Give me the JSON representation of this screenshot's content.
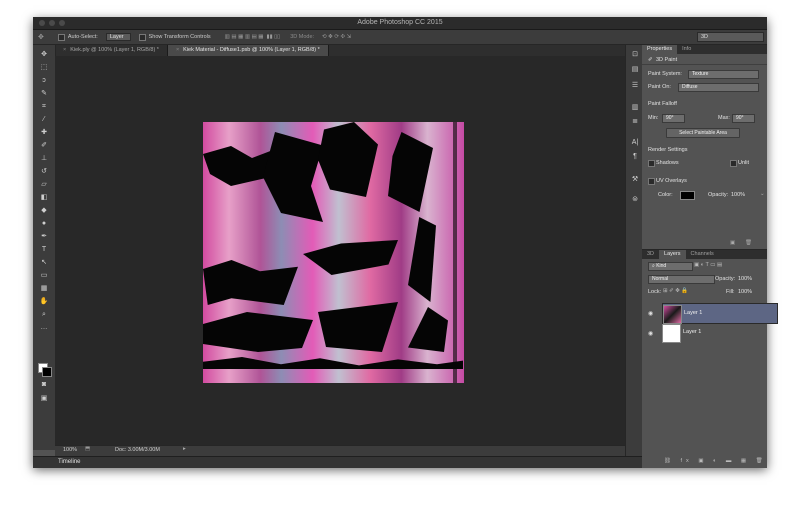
{
  "window": {
    "title": "Adobe Photoshop CC 2015"
  },
  "options_bar": {
    "auto_select_label": "Auto-Select:",
    "auto_select_value": "Layer",
    "show_transform_label": "Show Transform Controls",
    "mode_3d_label": "3D Mode:",
    "workspace_value": "3D"
  },
  "tabs": [
    {
      "label": "Kiek.ply @ 100% (Layer 1, RGB/8) *"
    },
    {
      "label": "Kiek Material - Diffuse1.psb @ 100% (Layer 1, RGB/8) *"
    }
  ],
  "status": {
    "zoom": "100%",
    "doc": "Doc: 3.00M/3.00M"
  },
  "timeline_label": "Timeline",
  "properties": {
    "tab_properties": "Properties",
    "tab_info": "Info",
    "header": "3D Paint",
    "paint_system_label": "Paint System:",
    "paint_system_value": "Texture",
    "paint_on_label": "Paint On:",
    "paint_on_value": "Diffuse",
    "paint_falloff_label": "Paint Falloff",
    "min_label": "Min:",
    "min_value": "90°",
    "max_label": "Max:",
    "max_value": "90°",
    "select_button": "Select Paintable Area",
    "render_settings_label": "Render Settings",
    "shadows_label": "Shadows",
    "unlit_label": "Unlit",
    "uv_overlays_label": "UV Overlays",
    "color_label": "Color:",
    "opacity_label": "Opacity:",
    "opacity_value": "100%"
  },
  "layers_panel": {
    "tab_3d": "3D",
    "tab_layers": "Layers",
    "tab_channels": "Channels",
    "kind_label": "Kind",
    "blend_mode": "Normal",
    "opacity_label": "Opacity:",
    "opacity_value": "100%",
    "lock_label": "Lock:",
    "fill_label": "Fill:",
    "fill_value": "100%",
    "layers": [
      {
        "name": "Layer 1"
      },
      {
        "name": "Layer 1"
      }
    ]
  },
  "colors": {
    "accent_selected_layer": "#5d6684",
    "canvas_bg": "#282828",
    "panel_bg": "#535353"
  }
}
